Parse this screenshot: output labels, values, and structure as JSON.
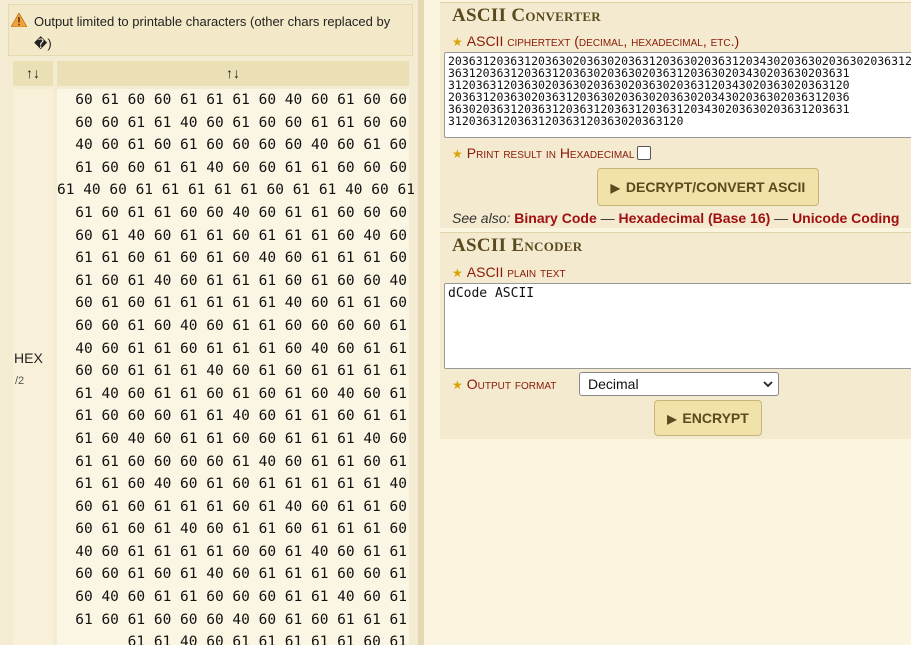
{
  "warning": {
    "text": "Output limited to printable characters (other chars replaced by �)"
  },
  "results": {
    "col1_sort": "↑↓",
    "col2_sort": "↑↓",
    "row_label": "HEX",
    "row_sub": "/2",
    "lines": [
      "60 61 60 60 61 61 61 60 40 60 61 60 60",
      "60 60 61 61 40 60 61 60 60 61 61 60 60",
      "40 60 61 60 61 60 60 60 60 40 60 61 60",
      "61 60 60 61 61 40 60 60 61 61 60 60 60",
      "61 40 60 61 61 61 61 61 60 61 61 40 60 61",
      "61 60 61 61 60 60 40 60 61 61 60 60 60",
      "60 61 40 60 61 61 60 61 61 61 60 40 60",
      "61 61 60 61 60 61 60 40 60 61 61 61 60",
      "61 60 61 40 60 61 61 61 60 61 60 60 40",
      "60 61 60 61 61 61 61 61 40 60 61 61 60",
      "60 60 61 60 40 60 61 61 60 60 60 60 61",
      "40 60 61 61 60 61 61 61 60 40 60 61 61",
      "60 60 61 61 61 40 60 61 60 61 61 61 61",
      "61 40 60 61 61 60 61 60 61 60 40 60 61",
      "61 60 60 60 61 61 40 60 61 61 60 61 61",
      "61 60 40 60 61 61 60 60 61 61 61 40 60",
      "61 61 60 60 60 60 61 40 60 61 61 60 61",
      "61 61 60 40 60 61 60 61 61 61 61 61 40",
      "60 61 60 61 61 61 60 61 40 60 61 61 60",
      "60 61 60 61 40 60 61 61 60 61 61 61 60",
      "40 60 61 61 61 61 60 60 61 40 60 61 61",
      "60 60 61 60 61 40 60 61 61 61 60 60 61",
      "60 40 60 61 61 60 60 60 61 61 40 60 61",
      "61 60 61 60 60 60 40 60 61 60 61 61 61",
      "61 61 40 60 61 61 61 61 61 60 61"
    ]
  },
  "converter": {
    "title": "ASCII Converter",
    "field_label": "ASCII ciphertext (decimal, hexadecimal, etc.)",
    "ciphertext_lines": [
      "2036312036312036302036302036312036302036312034302036302036302036312",
      "3631203631203631203630203630203631203630203430203630203631",
      "3120363120363020363020363020363020363120343020363020363120",
      "2036312036302036312036302036302036302034302036302036312036",
      "3630203631203631203631203631203631203430203630203631203631",
      "3120363120363120363120363020363120"
    ],
    "hex_option_label": "Print result in Hexadecimal",
    "button_label": "DECRYPT/CONVERT ASCII",
    "see_also_label": "See also:",
    "links": [
      "Binary Code",
      "Hexadecimal (Base 16)",
      "Unicode Coding"
    ],
    "separator": " — "
  },
  "encoder": {
    "title": "ASCII Encoder",
    "field_label": "ASCII plain text",
    "plaintext": "dCode ASCII",
    "format_label": "Output format",
    "format_value": "Decimal",
    "button_label": "ENCRYPT"
  },
  "colors": {
    "accent_red": "#a01010",
    "button_bg": "#f0e2a8",
    "panel_bg": "#f3ead0"
  }
}
